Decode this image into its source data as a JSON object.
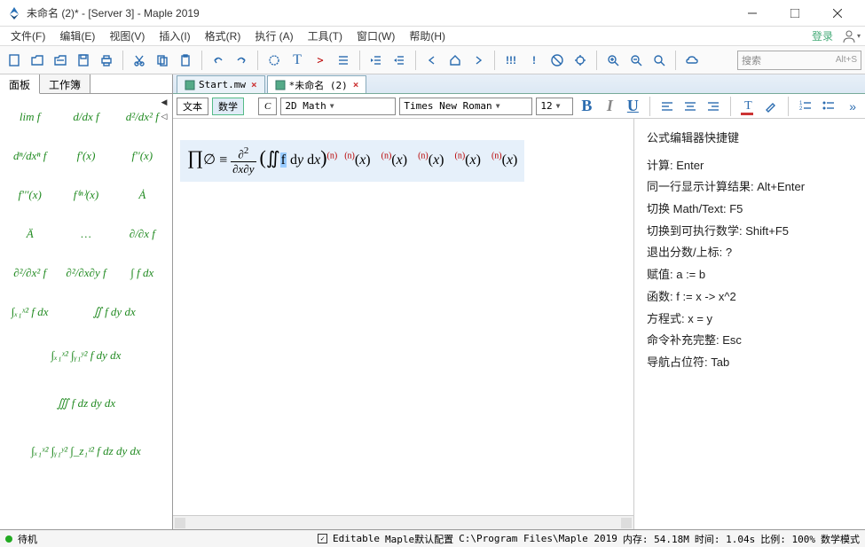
{
  "title": "未命名 (2)* - [Server 3] - Maple 2019",
  "menu": [
    "文件(F)",
    "编辑(E)",
    "视图(V)",
    "插入(I)",
    "格式(R)",
    "执行 (A)",
    "工具(T)",
    "窗口(W)",
    "帮助(H)"
  ],
  "login": "登录",
  "search": {
    "placeholder": "搜索",
    "hint": "Alt+S"
  },
  "panelTabs": {
    "t1": "面板",
    "t2": "工作簿"
  },
  "palette": {
    "r1c1": "lim  f",
    "r1c2": "d/dx f",
    "r1c3": "d²/dx² f",
    "r2c1": "dⁿ/dxⁿ f",
    "r2c2": "f'(x)",
    "r2c3": "f''(x)",
    "r3c1": "f'''(x)",
    "r3c2": "f⁽ⁿ⁾(x)",
    "r3c3": "Ȧ",
    "r4c1": "Ä",
    "r4c2": "…",
    "r4c3": "∂/∂x f",
    "r5c1": "∂²/∂x² f",
    "r5c2": "∂²/∂x∂y f",
    "r5c3": "∫ f dx",
    "r6a": "∫ₓ₁ˣ² f dx",
    "r6b": "∬ f dy dx",
    "r7": "∫ₓ₁ˣ² ∫ᵧ₁ʸ² f dy dx",
    "r8": "∭ f dz dy dx",
    "r9": "∫ₓ₁ˣ² ∫ᵧ₁ʸ² ∫_z₁ᶻ² f dz dy dx"
  },
  "docTabs": {
    "t1": "Start.mw",
    "t2": "*未命名 (2)"
  },
  "fmt": {
    "textBtn": "文本",
    "mathBtn": "数学",
    "styleC": "C",
    "style": "2D Math",
    "font": "Times New Roman",
    "size": "12",
    "B": "B",
    "I": "I",
    "U": "U"
  },
  "help": {
    "title": "公式编辑器快捷键",
    "l1": "计算:  Enter",
    "l2": "同一行显示计算结果:  Alt+Enter",
    "l3": "切换 Math/Text:  F5",
    "l4": "切换到可执行数学:  Shift+F5",
    "l5": "退出分数/上标:  ?",
    "l6": "赋值:  a := b",
    "l7": "函数:  f := x -> x^2",
    "l8": "方程式:  x = y",
    "l9": "命令补充完整:  Esc",
    "l10": "导航占位符:  Tab"
  },
  "status": {
    "ready": "待机",
    "editable": "Editable",
    "config": "Maple默认配置",
    "path": "C:\\Program Files\\Maple 2019",
    "mem": "内存: 54.18M",
    "time": "时间: 1.04s",
    "scale": "比例: 100%",
    "mode": "数学模式"
  }
}
